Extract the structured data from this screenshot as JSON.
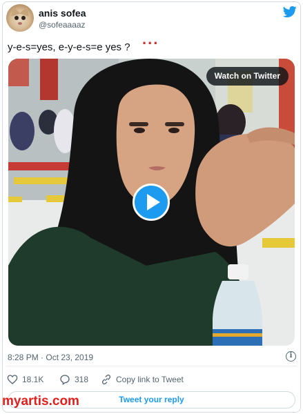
{
  "author": {
    "name": "anis sofea",
    "handle": "@sofeaaaaz"
  },
  "tweet": {
    "text": "y-e-s=yes, e-y-e-s=e yes ?",
    "annotation": "...",
    "timestamp": "8:28 PM · Oct 23, 2019"
  },
  "video": {
    "watch_label": "Watch on Twitter"
  },
  "actions": {
    "likes": "18.1K",
    "replies": "318",
    "copy_link_label": "Copy link to Tweet",
    "reply_button_label": "Tweet your reply"
  },
  "watermark": "myartis.com",
  "colors": {
    "accent": "#1d9bf0",
    "secondary_text": "#536471",
    "annotation": "#d0312d",
    "watermark": "#e0201c"
  },
  "icons": {
    "brand": "twitter-bird-icon",
    "info": "info-icon",
    "like": "heart-icon",
    "reply": "reply-bubble-icon",
    "copy": "link-icon",
    "play": "play-icon"
  }
}
